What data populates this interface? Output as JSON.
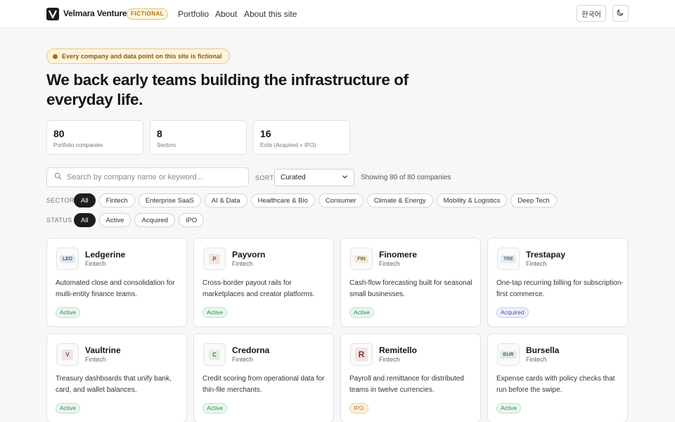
{
  "header": {
    "brand": "Velmara Ventures",
    "badge": "FICTIONAL",
    "nav": [
      "Portfolio",
      "About",
      "About this site"
    ],
    "lang_button": "한국어",
    "theme_icon": "moon-icon"
  },
  "hero": {
    "notice": "Every company and data point on this site is fictional",
    "headline": "We back early teams building the infrastructure of everyday life."
  },
  "stats": [
    {
      "value": "80",
      "label": "Portfolio companies"
    },
    {
      "value": "8",
      "label": "Sectors"
    },
    {
      "value": "16",
      "label": "Exits (Acquired + IPO)"
    }
  ],
  "controls": {
    "search_placeholder": "Search by company name or keyword...",
    "search_value": "",
    "sort_label": "SORT",
    "sort_value": "Curated",
    "showing": "Showing 80 of 80 companies"
  },
  "filters": {
    "sector_label": "SECTOR",
    "sectors": [
      "All",
      "Fintech",
      "Enterprise SaaS",
      "AI & Data",
      "Healthcare & Bio",
      "Consumer",
      "Climate & Energy",
      "Mobility & Logistics",
      "Deep Tech"
    ],
    "status_label": "STATUS",
    "statuses": [
      "All",
      "Active",
      "Acquired",
      "IPO"
    ]
  },
  "companies": [
    {
      "name": "Ledgerine",
      "sector": "Fintech",
      "logo_text": "LED",
      "logo_color": "#e3e8f3",
      "logo_ink": "#4a5a7a",
      "description": "Automated close and consolidation for multi-entity finance teams.",
      "status": "Active"
    },
    {
      "name": "Payvorn",
      "sector": "Fintech",
      "logo_text": "P",
      "logo_color": "#f5e4e2",
      "logo_ink": "#8a4a44",
      "description": "Cross-border payout rails for marketplaces and creator platforms.",
      "status": "Active"
    },
    {
      "name": "Finomere",
      "sector": "Fintech",
      "logo_text": "FIN",
      "logo_color": "#f3ead6",
      "logo_ink": "#7a6640",
      "description": "Cash-flow forecasting built for seasonal small businesses.",
      "status": "Active"
    },
    {
      "name": "Trestapay",
      "sector": "Fintech",
      "logo_text": "TRE",
      "logo_color": "#e6ebf1",
      "logo_ink": "#5b6a7d",
      "description": "One-tap recurring billing for subscription-first commerce.",
      "status": "Acquired"
    },
    {
      "name": "Vaultrine",
      "sector": "Fintech",
      "logo_text": "V",
      "logo_color": "#efe3ec",
      "logo_ink": "#6e4a63",
      "description": "Treasury dashboards that unify bank, card, and wallet balances.",
      "status": "Active"
    },
    {
      "name": "Credorna",
      "sector": "Fintech",
      "logo_text": "C",
      "logo_color": "#e4efe3",
      "logo_ink": "#4e6a4c",
      "description": "Credit scoring from operational data for thin-file merchants.",
      "status": "Active"
    },
    {
      "name": "Remitello",
      "sector": "Fintech",
      "logo_text": "R",
      "logo_color": "#f3e3e0",
      "logo_ink": "#7a3c34",
      "description": "Payroll and remittance for distributed teams in twelve currencies.",
      "status": "IPO"
    },
    {
      "name": "Bursella",
      "sector": "Fintech",
      "logo_text": "BUR",
      "logo_color": "#e3e9ec",
      "logo_ink": "#5a6b74",
      "description": "Expense cards with policy checks that run before the swipe.",
      "status": "Active"
    }
  ]
}
